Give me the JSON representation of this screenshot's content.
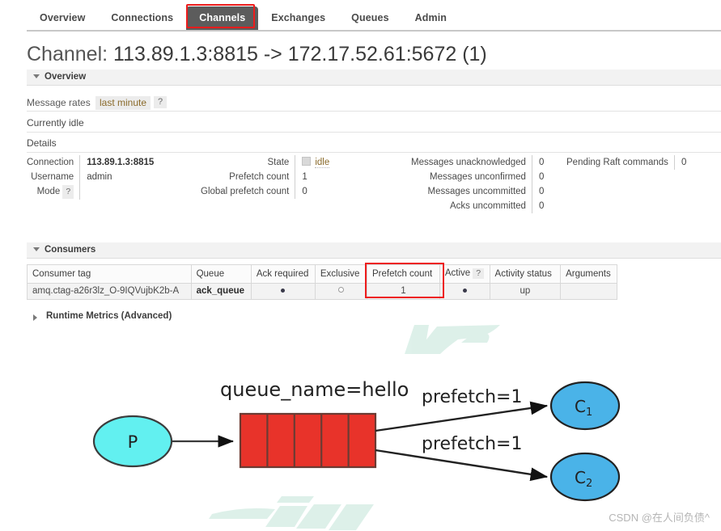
{
  "nav": {
    "tabs": [
      {
        "label": "Overview",
        "selected": false
      },
      {
        "label": "Connections",
        "selected": false
      },
      {
        "label": "Channels",
        "selected": true
      },
      {
        "label": "Exchanges",
        "selected": false
      },
      {
        "label": "Queues",
        "selected": false
      },
      {
        "label": "Admin",
        "selected": false
      }
    ],
    "highlight_color": "#ee1c1c",
    "selected_tab_bg": "#5c5c5c"
  },
  "page": {
    "title_label": "Channel:",
    "title_value": "113.89.1.3:8815 -> 172.17.52.61:5672 (1)"
  },
  "overview": {
    "section_label": "Overview",
    "message_rates_label": "Message rates",
    "message_rates_period": "last minute",
    "help_glyph": "?",
    "idle_text": "Currently idle",
    "details_text": "Details"
  },
  "details": {
    "left": [
      {
        "key": "Connection",
        "value": "113.89.1.3:8815",
        "bold": true
      },
      {
        "key": "Username",
        "value": "admin",
        "bold": false
      },
      {
        "key": "Mode",
        "value": "",
        "bold": false,
        "help": true
      }
    ],
    "middle": [
      {
        "key": "State",
        "value": "idle",
        "badge": true
      },
      {
        "key": "Prefetch count",
        "value": "1"
      },
      {
        "key": "Global prefetch count",
        "value": "0"
      }
    ],
    "right": [
      {
        "key": "Messages unacknowledged",
        "value": "0"
      },
      {
        "key": "Messages unconfirmed",
        "value": "0"
      },
      {
        "key": "Messages uncommitted",
        "value": "0"
      },
      {
        "key": "Acks uncommitted",
        "value": "0"
      }
    ],
    "far_right": [
      {
        "key": "Pending Raft commands",
        "value": "0"
      }
    ]
  },
  "consumers": {
    "section_label": "Consumers",
    "columns": [
      "Consumer tag",
      "Queue",
      "Ack required",
      "Exclusive",
      "Prefetch count",
      "Active",
      "Activity status",
      "Arguments"
    ],
    "active_help_glyph": "?",
    "rows": [
      {
        "consumer_tag": "amq.ctag-a26r3lz_O-9IQVujbK2b-A",
        "queue": "ack_queue",
        "ack_required": "filled-dot",
        "exclusive": "empty-dot",
        "prefetch_count": "1",
        "active": "filled-dot",
        "activity_status": "up",
        "arguments": ""
      }
    ],
    "highlight_column": "Prefetch count"
  },
  "runtime": {
    "label": "Runtime Metrics (Advanced)"
  },
  "diagram": {
    "queue_label": "queue_name=hello",
    "producer_label": "P",
    "consumer_1_label": "C",
    "consumer_1_sub": "1",
    "consumer_2_label": "C",
    "consumer_2_sub": "2",
    "edge_label_1": "prefetch=1",
    "edge_label_2": "prefetch=1",
    "producer_color": "#62f0f0",
    "queue_color": "#e8332a",
    "consumer_color": "#4ab3e8",
    "queue_cells": 5
  },
  "watermark": {
    "text": "CSDN @在人间负债^"
  }
}
